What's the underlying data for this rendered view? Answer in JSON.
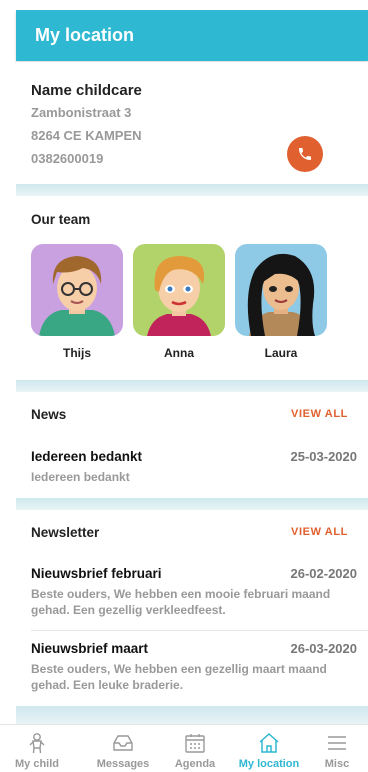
{
  "header": {
    "title": "My location"
  },
  "location": {
    "name": "Name childcare",
    "street": "Zambonistraat 3",
    "city": "8264 CE KAMPEN",
    "phone": "0382600019"
  },
  "team": {
    "title": "Our team",
    "members": [
      {
        "name": "Thijs",
        "bg": "#c9a0e0"
      },
      {
        "name": "Anna",
        "bg": "#b2d36a"
      },
      {
        "name": "Laura",
        "bg": "#8ec9e6"
      }
    ]
  },
  "news": {
    "title": "News",
    "view_all": "VIEW ALL",
    "items": [
      {
        "title": "Iedereen bedankt",
        "date": "25-03-2020",
        "summary": "Iedereen bedankt"
      }
    ]
  },
  "newsletter": {
    "title": "Newsletter",
    "view_all": "VIEW ALL",
    "items": [
      {
        "title": "Nieuwsbrief februari",
        "date": "26-02-2020",
        "summary": "Beste ouders,  We hebben een mooie februari maand gehad. Een gezellig verkleedfeest."
      },
      {
        "title": "Nieuwsbrief maart",
        "date": "26-03-2020",
        "summary": "Beste ouders,  We hebben een gezellig maart maand gehad. Een leuke braderie."
      }
    ]
  },
  "nav": {
    "items": [
      {
        "label": "My child",
        "icon": "child-icon"
      },
      {
        "label": "Messages",
        "icon": "inbox-icon"
      },
      {
        "label": "Agenda",
        "icon": "calendar-icon"
      },
      {
        "label": "My location",
        "icon": "home-icon",
        "active": true
      },
      {
        "label": "Misc",
        "icon": "menu-icon"
      }
    ]
  },
  "colors": {
    "brand": "#2fb8d2",
    "accent": "#e0602f"
  }
}
